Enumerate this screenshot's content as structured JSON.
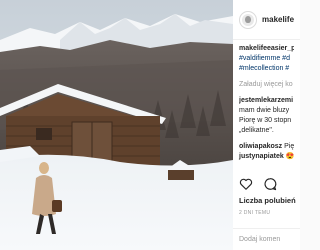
{
  "post": {
    "username": "makelife",
    "avatar_icon": "profile-avatar"
  },
  "caption": {
    "user": "makelifeeasier_p",
    "tags_line1": "#valdifiemme #d",
    "tags_line2": "#mlecollection #",
    "translate": "Załaduj więcej ko"
  },
  "comments": [
    {
      "user": "jestemlekarzemi",
      "lines": [
        "mam dwie bluzy",
        "Piorę w 30 stopn",
        "„delikatne\"."
      ]
    },
    {
      "user": "oliwiapakosz",
      "text": "Pię"
    },
    {
      "user": "justynapiatek",
      "text": "😍"
    }
  ],
  "likes": "Liczba polubień",
  "date": "2 DNI TEMU",
  "add_comment_placeholder": "Dodaj komen",
  "colors": {
    "link": "#003569",
    "muted": "#999999",
    "border": "#efefef"
  },
  "icons": [
    "heart-icon",
    "comment-icon"
  ]
}
